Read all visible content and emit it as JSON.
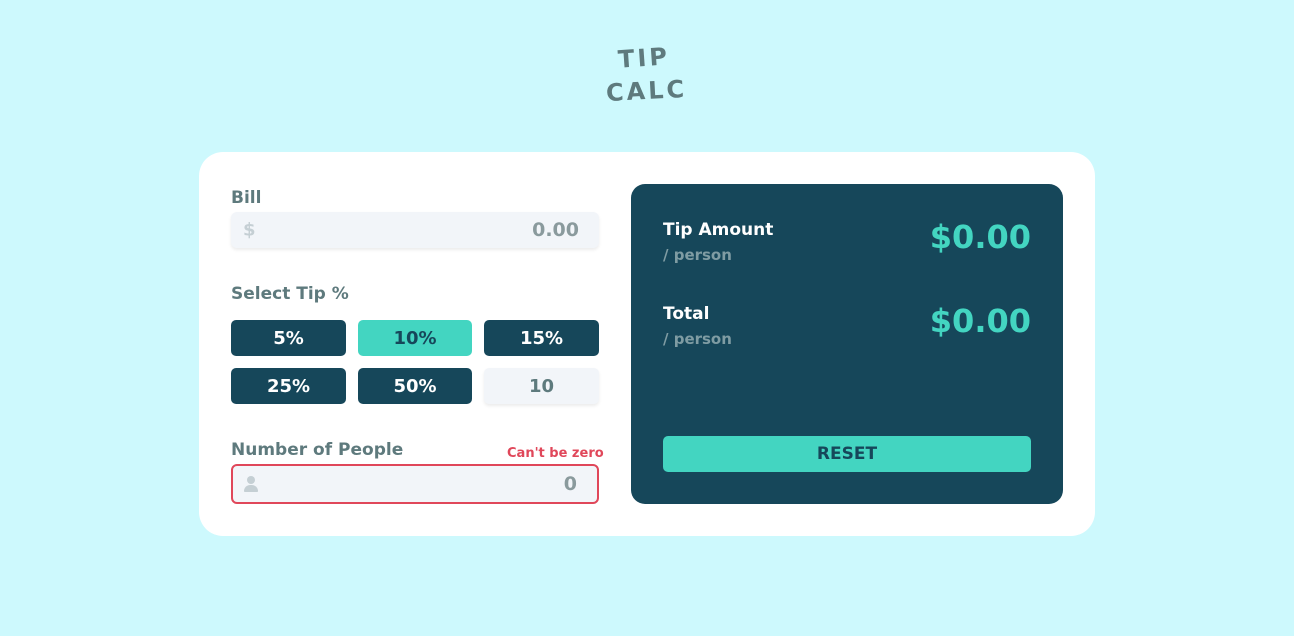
{
  "logo": {
    "line1": "TIP",
    "line2": "CALC"
  },
  "bill": {
    "label": "Bill",
    "currency_symbol": "$",
    "value": "0.00"
  },
  "tip": {
    "label": "Select Tip %",
    "options": [
      "5%",
      "10%",
      "15%",
      "25%",
      "50%"
    ],
    "selected": "10%",
    "custom_value": "10"
  },
  "people": {
    "label": "Number of People",
    "error": "Can't be zero",
    "value": "0",
    "icon": "person-icon"
  },
  "results": {
    "tip_amount_label": "Tip Amount",
    "tip_amount_sub": "/ person",
    "tip_amount_value": "$0.00",
    "total_label": "Total",
    "total_sub": "/ person",
    "total_value": "$0.00",
    "reset_label": "RESET"
  },
  "colors": {
    "background": "#cdf9fd",
    "dark_cyan": "#16475a",
    "accent": "#43d5c1",
    "error": "#e0475a"
  }
}
